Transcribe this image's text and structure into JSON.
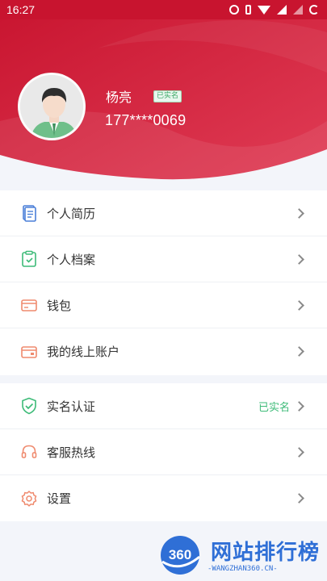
{
  "status_bar": {
    "time": "16:27",
    "icons": [
      "alarm-icon",
      "vibrate-icon",
      "wifi-icon",
      "cell-signal-icon",
      "cell-signal-icon",
      "battery-icon"
    ]
  },
  "profile": {
    "name": "杨亮",
    "verified_badge": "已实名",
    "phone": "177****0069"
  },
  "menu_group_1": [
    {
      "label": "个人简历",
      "icon": "resume-icon"
    },
    {
      "label": "个人档案",
      "icon": "archive-icon"
    },
    {
      "label": "钱包",
      "icon": "wallet-icon"
    },
    {
      "label": "我的线上账户",
      "icon": "online-account-icon"
    }
  ],
  "menu_group_2": [
    {
      "label": "实名认证",
      "status": "已实名",
      "icon": "shield-check-icon"
    },
    {
      "label": "客服热线",
      "icon": "headset-icon"
    },
    {
      "label": "设置",
      "icon": "settings-icon"
    }
  ],
  "watermark": {
    "logo_text": "360",
    "title": "网站排行榜",
    "subtitle": "-WANGZHAN360.CN-"
  },
  "colors": {
    "primary": "#c8142f",
    "verified": "#3dbb78",
    "background": "#f3f5fa"
  }
}
